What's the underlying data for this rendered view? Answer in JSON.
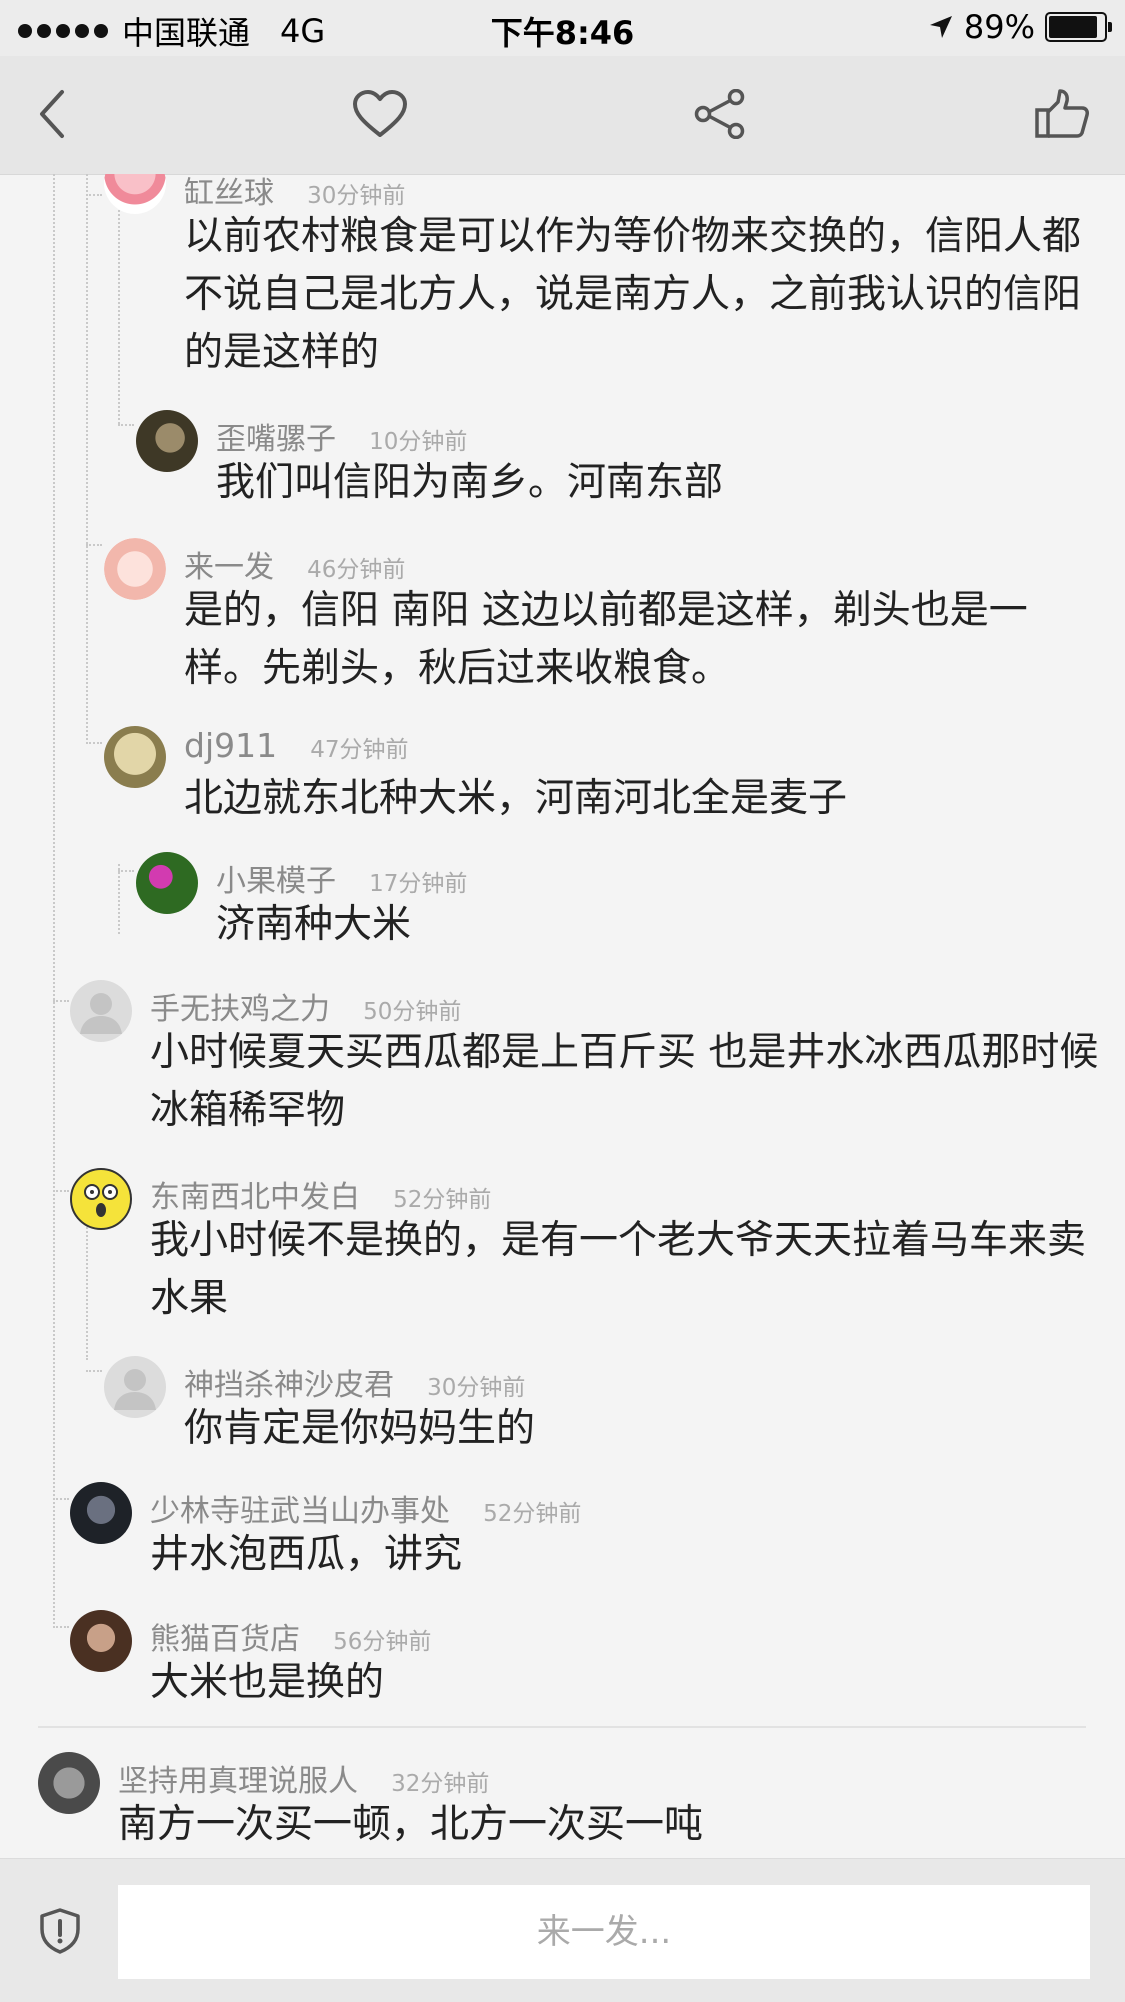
{
  "status_bar": {
    "carrier": "中国联通",
    "network": "4G",
    "time": "下午8:46",
    "battery": "89%",
    "battery_level": 0.89
  },
  "toolbar": {
    "back_icon": "chevron-left-icon",
    "favorite_icon": "heart-icon",
    "share_icon": "share-icon",
    "like_icon": "thumbs-up-icon"
  },
  "comments": [
    {
      "user": "缸丝球",
      "time": "30分钟前",
      "text": "以前农村粮食是可以作为等价物来交换的，信阳人都不说自己是北方人，说是南方人，之前我认识的信阳的是这样的"
    },
    {
      "user": "歪嘴骡子",
      "time": "10分钟前",
      "text": "我们叫信阳为南乡。河南东部"
    },
    {
      "user": "来一发",
      "time": "46分钟前",
      "text": "是的，信阳 南阳 这边以前都是这样，剃头也是一样。先剃头，秋后过来收粮食。"
    },
    {
      "user": "dj911",
      "time": "47分钟前",
      "text": "北边就东北种大米，河南河北全是麦子"
    },
    {
      "user": "小果模子",
      "time": "17分钟前",
      "text": "济南种大米"
    },
    {
      "user": "手无扶鸡之力",
      "time": "50分钟前",
      "text": "小时候夏天买西瓜都是上百斤买  也是井水冰西瓜那时候冰箱稀罕物"
    },
    {
      "user": "东南西北中发白",
      "time": "52分钟前",
      "text": "我小时候不是换的，是有一个老大爷天天拉着马车来卖水果"
    },
    {
      "user": "神挡杀神沙皮君",
      "time": "30分钟前",
      "text": "你肯定是你妈妈生的"
    },
    {
      "user": "少林寺驻武当山办事处",
      "time": "52分钟前",
      "text": "井水泡西瓜，讲究"
    },
    {
      "user": "熊猫百货店",
      "time": "56分钟前",
      "text": "大米也是换的"
    },
    {
      "user": "坚持用真理说服人",
      "time": "32分钟前",
      "text": "南方一次买一顿，北方一次买一吨"
    }
  ],
  "reply": {
    "placeholder": "来一发...",
    "shield_icon": "shield-icon"
  }
}
